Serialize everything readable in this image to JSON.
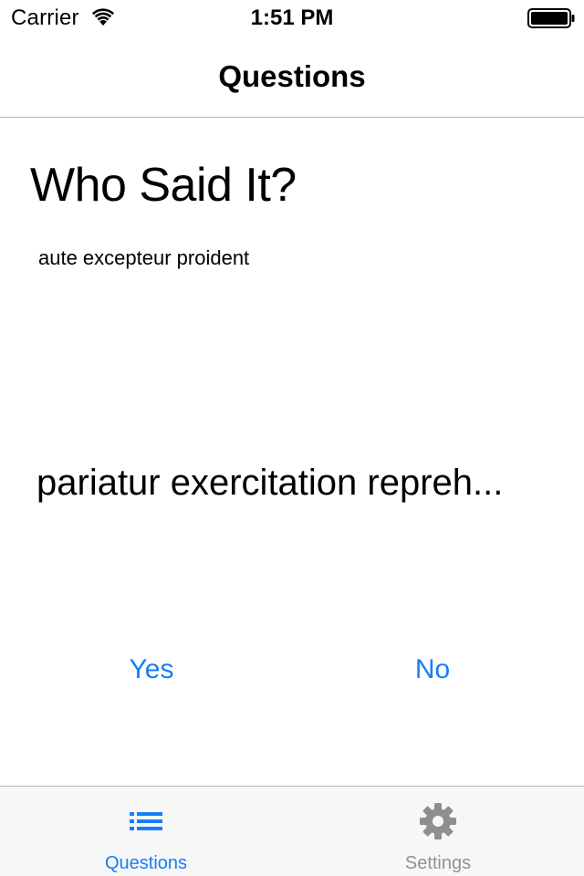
{
  "status_bar": {
    "carrier": "Carrier",
    "time": "1:51 PM",
    "wifi_icon": "wifi-icon",
    "battery_icon": "battery-icon"
  },
  "nav": {
    "title": "Questions"
  },
  "main": {
    "heading": "Who Said It?",
    "subtitle": "aute excepteur proident",
    "quote": "pariatur exercitation repreh...",
    "yes_label": "Yes",
    "no_label": "No"
  },
  "tab_bar": {
    "tabs": [
      {
        "label": "Questions",
        "icon": "list-icon",
        "selected": true
      },
      {
        "label": "Settings",
        "icon": "gear-icon",
        "selected": false
      }
    ]
  },
  "colors": {
    "accent": "#157efb",
    "inactive_tab": "#929292",
    "tab_bar_bg": "#f7f7f7",
    "separator": "#b2b2b2"
  }
}
